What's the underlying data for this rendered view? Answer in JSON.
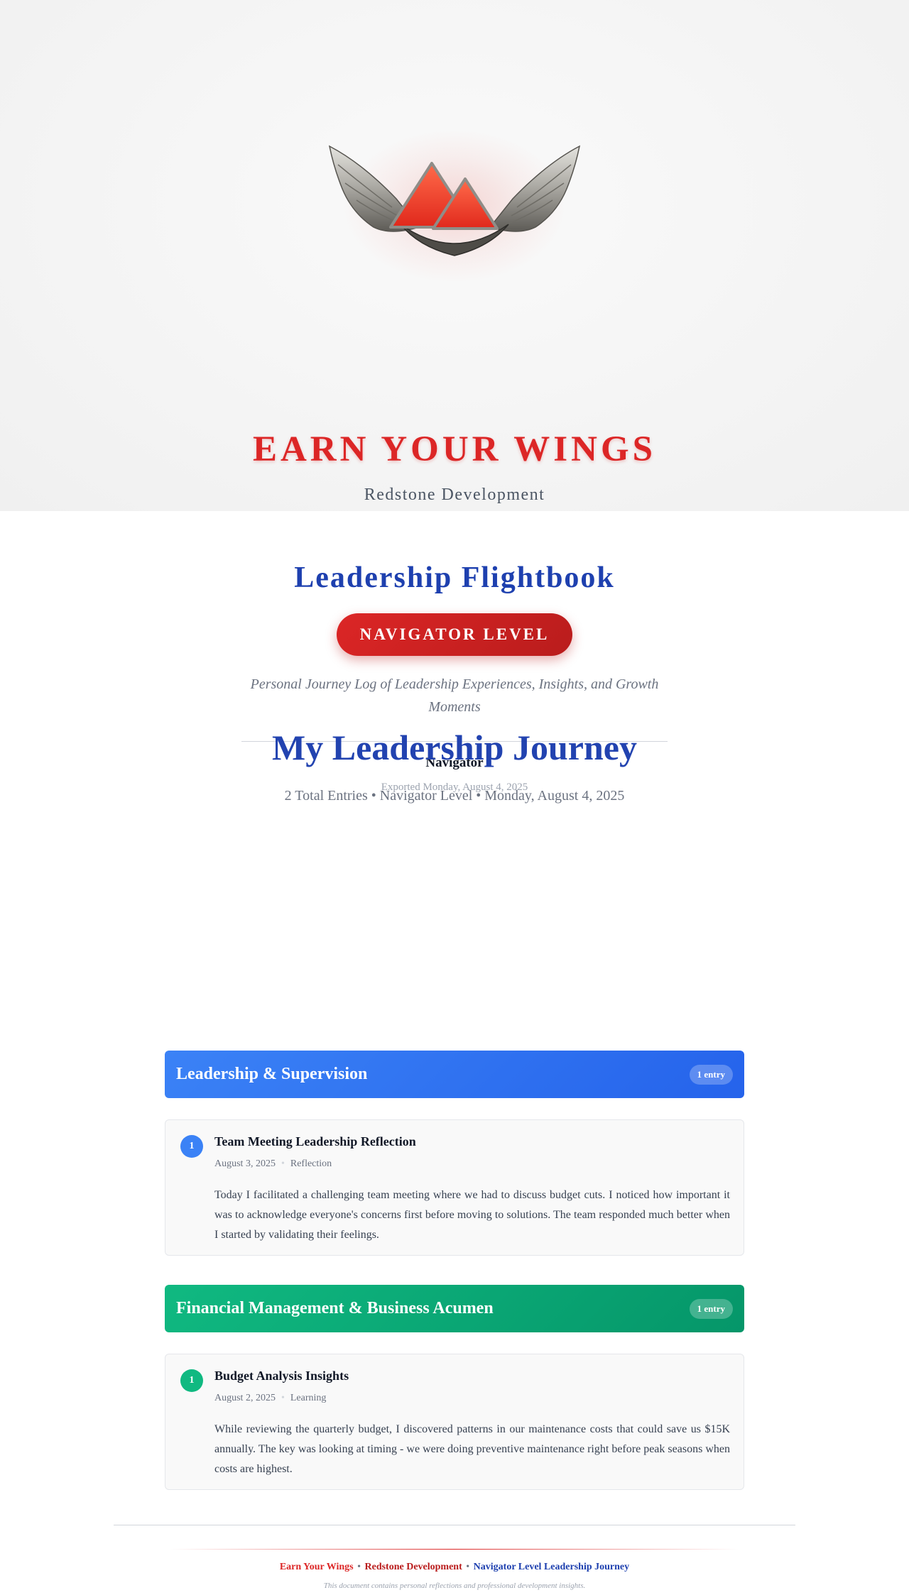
{
  "hero": {
    "logo_icon": "winged-mountain-badge-icon",
    "brand_title": "EARN YOUR WINGS",
    "brand_subtitle": "Redstone Development"
  },
  "flightbook": {
    "title": "Leadership Flightbook",
    "level_badge": "NAVIGATOR LEVEL",
    "tagline": "Personal Journey Log of Leadership Experiences, Insights, and Growth Moments",
    "navigator_name": "Navigator",
    "exported": "Exported Monday, August 4, 2025"
  },
  "journey": {
    "title": "My Leadership Journey",
    "meta": "2 Total Entries • Navigator Level • Monday, August 4, 2025"
  },
  "categories": [
    {
      "title": "Leadership & Supervision",
      "count": "1 entry",
      "color": "#3b82f6",
      "entries": [
        {
          "number": "1",
          "title": "Team Meeting Leadership Reflection",
          "date": "August 3, 2025",
          "separator": "•",
          "type": "Reflection",
          "body": "Today I facilitated a challenging team meeting where we had to discuss budget cuts. I noticed how important it was to acknowledge everyone's concerns first before moving to solutions. The team responded much better when I started by validating their feelings."
        }
      ]
    },
    {
      "title": "Financial Management & Business Acumen",
      "count": "1 entry",
      "color": "#10b981",
      "entries": [
        {
          "number": "1",
          "title": "Budget Analysis Insights",
          "date": "August 2, 2025",
          "separator": "•",
          "type": "Learning",
          "body": "While reviewing the quarterly budget, I discovered patterns in our maintenance costs that could save us $15K annually. The key was looking at timing - we were doing preventive maintenance right before peak seasons when costs are highest."
        }
      ]
    }
  ],
  "footer": {
    "part1": "Earn Your Wings",
    "sep": "•",
    "part2": "Redstone Development",
    "part3": "Navigator Level Leadership Journey",
    "note": "This document contains personal reflections and professional development insights."
  },
  "colors": {
    "brand_red": "#dc2626",
    "brand_blue": "#1e40af",
    "category_blue": "#3b82f6",
    "category_green": "#10b981"
  }
}
